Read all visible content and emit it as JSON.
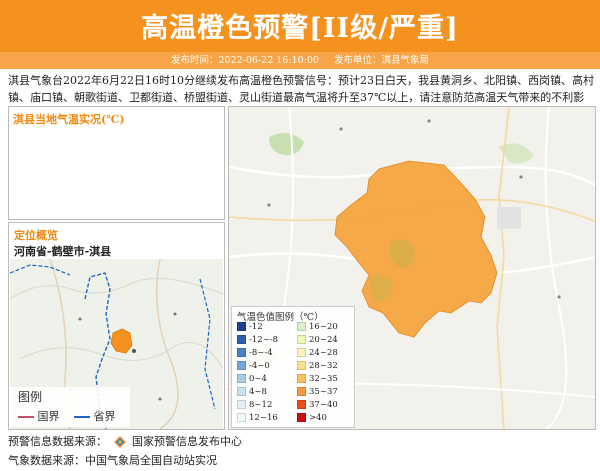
{
  "header": {
    "title": "高温橙色预警[II级/严重]",
    "publish_time_label": "发布时间：2022-06-22 16:10:00",
    "publisher_label": "发布单位：淇县气象局",
    "color": "#f5921e"
  },
  "description": "淇县气象台2022年6月22日16时10分继续发布高温橙色预警信号：预计23日白天，我县黄洞乡、北阳镇、西岗镇、高村镇、庙口镇、朝歌街道、卫都街道、桥盟街道、灵山街道最高气温将升至37℃以上，请注意防范高温天气带来的不利影响。",
  "temp_panel": {
    "title": "淇县当地气温实况(℃)"
  },
  "location_panel": {
    "title": "定位概览",
    "region": "河南省-鹤壁市-淇县",
    "legend_title": "图例",
    "legend_items": [
      {
        "label": "国界",
        "color": "#c0506a"
      },
      {
        "label": "省界",
        "color": "#1e64c8"
      }
    ]
  },
  "temp_legend": {
    "title": "气温色值图例（℃）",
    "items": [
      {
        "label": "-12",
        "color": "#1f3f8f"
      },
      {
        "label": "-12~-8",
        "color": "#2f5fb0"
      },
      {
        "label": "-8~-4",
        "color": "#4a80c8"
      },
      {
        "label": "-4~0",
        "color": "#74a6dc"
      },
      {
        "label": "0~4",
        "color": "#a8cbe8"
      },
      {
        "label": "4~8",
        "color": "#c8e2f2"
      },
      {
        "label": "8~12",
        "color": "#e4f2f8"
      },
      {
        "label": "12~16",
        "color": "#f2f9fb"
      },
      {
        "label": "16~20",
        "color": "#d8efc8"
      },
      {
        "label": "20~24",
        "color": "#eef7b8"
      },
      {
        "label": "24~28",
        "color": "#fbf3b8"
      },
      {
        "label": "28~32",
        "color": "#fde08a"
      },
      {
        "label": "32~35",
        "color": "#fbc060"
      },
      {
        "label": "35~37",
        "color": "#f79a40"
      },
      {
        "label": "37~40",
        "color": "#e8501e"
      },
      {
        "label": ">40",
        "color": "#c81010"
      }
    ]
  },
  "footer": {
    "source_label": "预警信息数据来源：",
    "source_value": "国家预警信息发布中心",
    "weather_label": "气象数据来源：",
    "weather_value": "中国气象局全国自动站实况"
  }
}
